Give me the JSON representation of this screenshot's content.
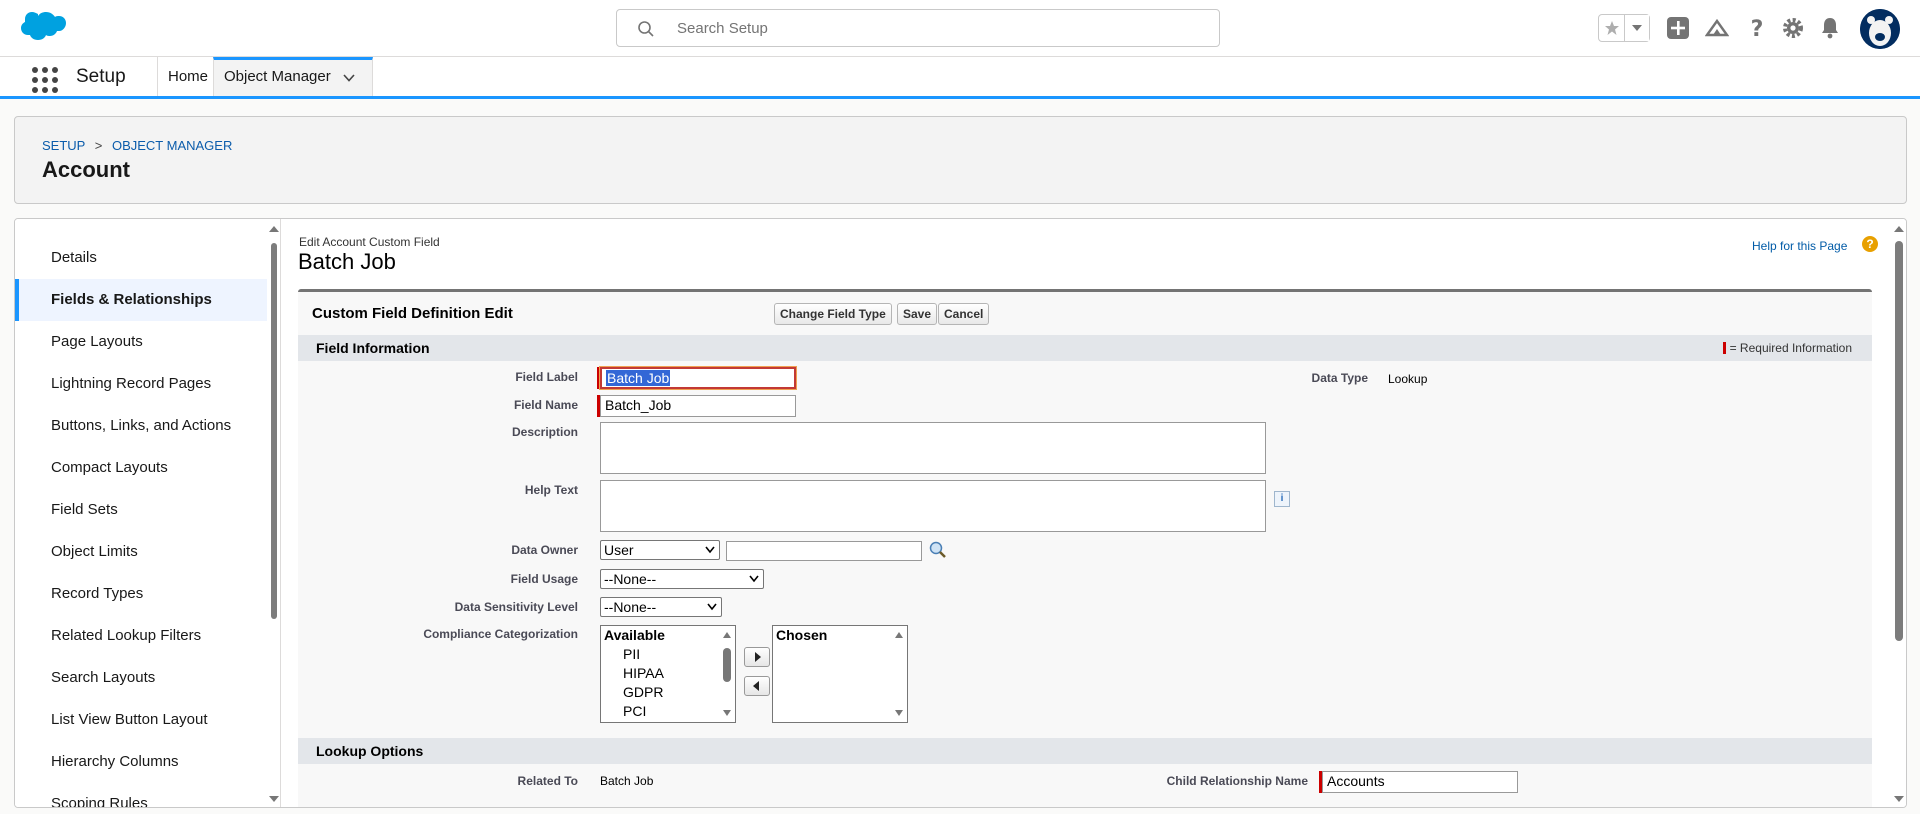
{
  "header": {
    "search_placeholder": "Search Setup"
  },
  "context_nav": {
    "app_name": "Setup",
    "tabs": [
      {
        "label": "Home"
      },
      {
        "label": "Object Manager"
      }
    ]
  },
  "page_header": {
    "breadcrumb": [
      "SETUP",
      "OBJECT MANAGER"
    ],
    "title": "Account"
  },
  "sidebar": {
    "items": [
      {
        "label": "Details"
      },
      {
        "label": "Fields & Relationships",
        "active": true
      },
      {
        "label": "Page Layouts"
      },
      {
        "label": "Lightning Record Pages"
      },
      {
        "label": "Buttons, Links, and Actions"
      },
      {
        "label": "Compact Layouts"
      },
      {
        "label": "Field Sets"
      },
      {
        "label": "Object Limits"
      },
      {
        "label": "Record Types"
      },
      {
        "label": "Related Lookup Filters"
      },
      {
        "label": "Search Layouts"
      },
      {
        "label": "List View Button Layout"
      },
      {
        "label": "Hierarchy Columns"
      },
      {
        "label": "Scoping Rules"
      }
    ]
  },
  "edit": {
    "subtitle": "Edit Account Custom Field",
    "title": "Batch Job",
    "help_link": "Help for this Page",
    "help_icon": "?",
    "block_title": "Custom Field Definition Edit",
    "buttons": {
      "change_type": "Change Field Type",
      "save": "Save",
      "cancel": "Cancel"
    },
    "field_info": {
      "section_label": "Field Information",
      "required_legend": "= Required Information",
      "field_label_label": "Field Label",
      "field_label_value": "Batch Job",
      "field_name_label": "Field Name",
      "field_name_value": "Batch_Job",
      "description_label": "Description",
      "help_text_label": "Help Text",
      "data_owner_label": "Data Owner",
      "data_owner_value": "User",
      "field_usage_label": "Field Usage",
      "field_usage_value": "--None--",
      "sensitivity_label": "Data Sensitivity Level",
      "sensitivity_value": "--None--",
      "compliance_label": "Compliance Categorization",
      "available_header": "Available",
      "available_options": [
        "PII",
        "HIPAA",
        "GDPR",
        "PCI"
      ],
      "chosen_header": "Chosen",
      "data_type_label": "Data Type",
      "data_type_value": "Lookup"
    },
    "lookup_options": {
      "section_label": "Lookup Options",
      "related_to_label": "Related To",
      "related_to_value": "Batch Job",
      "child_rel_label": "Child Relationship Name",
      "child_rel_value": "Accounts"
    }
  },
  "colors": {
    "brand_blue": "#1b96ff",
    "link_blue": "#0b5cab",
    "required_red": "#c00000",
    "header_bg": "#ffffff"
  }
}
